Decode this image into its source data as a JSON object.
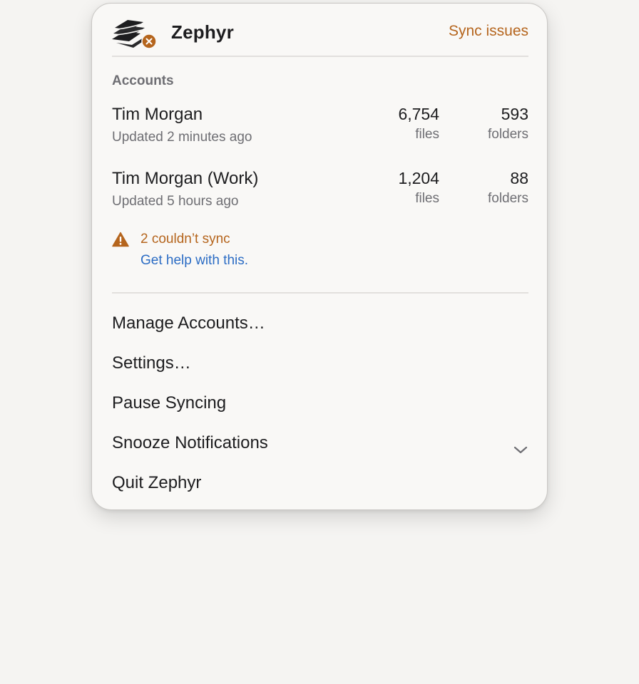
{
  "header": {
    "app_name": "Zephyr",
    "sync_issues_label": "Sync issues",
    "icon": "zephyr-logo-icon",
    "badge_icon": "error-badge-icon"
  },
  "accounts_section": {
    "label": "Accounts",
    "accounts": [
      {
        "name": "Tim Morgan",
        "updated": "Updated 2 minutes ago",
        "files_count": "6,754",
        "files_label": "files",
        "folders_count": "593",
        "folders_label": "folders"
      },
      {
        "name": "Tim Morgan (Work)",
        "updated": "Updated 5 hours ago",
        "files_count": "1,204",
        "files_label": "files",
        "folders_count": "88",
        "folders_label": "folders"
      }
    ]
  },
  "warning": {
    "icon": "warning-triangle-icon",
    "text": "2 couldn’t sync",
    "help_link": "Get help with this."
  },
  "menu": {
    "items": [
      {
        "label": "Manage Accounts…"
      },
      {
        "label": "Settings…"
      },
      {
        "label": "Pause Syncing"
      },
      {
        "label": "Snooze Notifications",
        "icon": "chevron-down-icon"
      },
      {
        "label": "Quit Zephyr"
      }
    ]
  },
  "colors": {
    "accent_warning": "#b5651d",
    "link": "#2b6cc4",
    "text_primary": "#1d1d1f",
    "text_secondary": "#6e6e73"
  }
}
